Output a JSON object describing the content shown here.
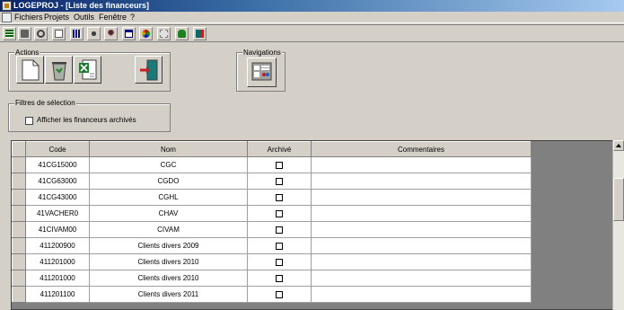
{
  "window": {
    "title": "LOGEPROJ - [Liste des financeurs]"
  },
  "menu": [
    "Fichiers",
    "Projets",
    "Outils",
    "Fenêtre",
    "?"
  ],
  "toolbar": {
    "icons": [
      "list-icon",
      "book-icon",
      "gear-icon",
      "doc-icon",
      "grid-icon",
      "people-icon",
      "person-icon",
      "calendar-icon",
      "palette-icon",
      "recycle-icon",
      "frog-icon",
      "exit-icon"
    ]
  },
  "actions": {
    "label": "Actions"
  },
  "navigations": {
    "label": "Navigations"
  },
  "filters": {
    "label": "Filtres de sélection",
    "archived_label": "Afficher les financeurs archivés",
    "archived_checked": false
  },
  "table": {
    "columns": [
      "Code",
      "Nom",
      "Archivé",
      "Commentaires"
    ],
    "rows": [
      {
        "code": "41CG15000",
        "nom": "CGC",
        "archive": false,
        "commentaires": ""
      },
      {
        "code": "41CG63000",
        "nom": "CGDO",
        "archive": false,
        "commentaires": ""
      },
      {
        "code": "41CG43000",
        "nom": "CGHL",
        "archive": false,
        "commentaires": ""
      },
      {
        "code": "41VACHER0",
        "nom": "CHAV",
        "archive": false,
        "commentaires": ""
      },
      {
        "code": "41CIVAM00",
        "nom": "CIVAM",
        "archive": false,
        "commentaires": ""
      },
      {
        "code": "411200900",
        "nom": "Clients divers 2009",
        "archive": false,
        "commentaires": ""
      },
      {
        "code": "411201000",
        "nom": "Clients divers 2010",
        "archive": false,
        "commentaires": ""
      },
      {
        "code": "411201000",
        "nom": "Clients divers 2010",
        "archive": false,
        "commentaires": ""
      },
      {
        "code": "411201100",
        "nom": "Clients divers 2011",
        "archive": false,
        "commentaires": ""
      }
    ]
  }
}
